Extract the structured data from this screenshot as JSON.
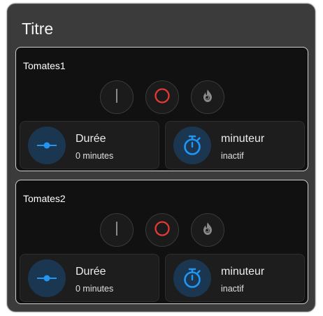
{
  "card": {
    "title": "Titre"
  },
  "entities": [
    {
      "name": "Tomates1",
      "controls": [
        {
          "icon": "power-off-line-icon"
        },
        {
          "icon": "power-on-circle-icon"
        },
        {
          "icon": "fire-boost-icon"
        }
      ],
      "tiles": [
        {
          "label": "Durée",
          "state": "0 minutes",
          "icon": "slider-icon"
        },
        {
          "label": "minuteur",
          "state": "inactif",
          "icon": "timer-icon"
        }
      ]
    },
    {
      "name": "Tomates2",
      "controls": [
        {
          "icon": "power-off-line-icon"
        },
        {
          "icon": "power-on-circle-icon"
        },
        {
          "icon": "fire-boost-icon"
        }
      ],
      "tiles": [
        {
          "label": "Durée",
          "state": "0 minutes",
          "icon": "slider-icon"
        },
        {
          "label": "minuteur",
          "state": "inactif",
          "icon": "timer-icon"
        }
      ]
    }
  ],
  "colors": {
    "accent": "#2196f3",
    "on_red": "#e53935",
    "tile_icon_bg": "#1b3650",
    "card_bg": "#111111",
    "outer_bg": "#3b3b3b"
  }
}
